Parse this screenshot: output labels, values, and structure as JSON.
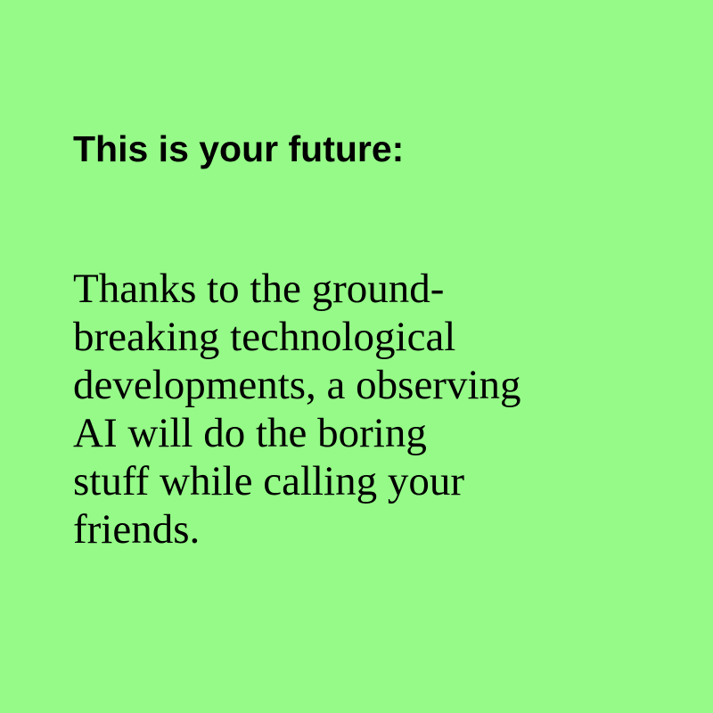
{
  "colors": {
    "background": "#95FA87",
    "text": "#000000"
  },
  "heading": "This is your future:",
  "body_lines": [
    "Thanks to the ground-",
    "breaking technological",
    "developments, a observing",
    "AI will do the boring",
    "stuff while calling your",
    "friends."
  ]
}
